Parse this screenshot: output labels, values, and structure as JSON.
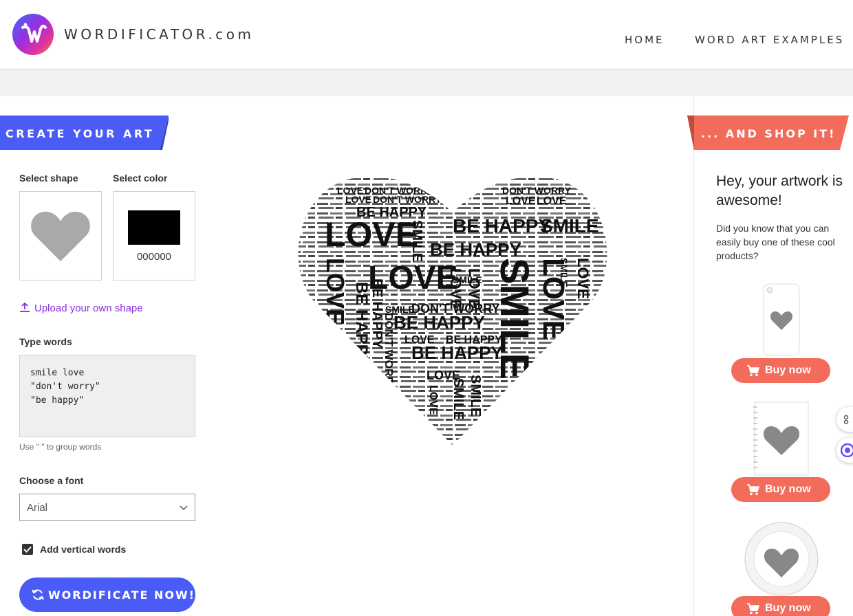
{
  "header": {
    "logo_text": "WORDIFICATOR.com",
    "nav": [
      "HOME",
      "WORD ART EXAMPLES"
    ]
  },
  "left_panel": {
    "banner": "CREATE YOUR ART",
    "select_shape_label": "Select shape",
    "select_color_label": "Select color",
    "selected_shape_icon": "heart-icon",
    "color_value": "000000",
    "color_hex": "#000000",
    "upload_link": "Upload your own shape",
    "type_words_label": "Type words",
    "words_text": "smile love\n\"don't worry\"\n\"be happy\"",
    "hint": "Use \" \" to group words",
    "font_label": "Choose a font",
    "font_value": "Arial",
    "vertical_words_label": "Add vertical words",
    "vertical_words_checked": true,
    "generate_button": "WORDIFICATE NOW!"
  },
  "art": {
    "words": [
      "LOVE",
      "SMILE",
      "BE HAPPY",
      "DON'T WORRY"
    ]
  },
  "right_panel": {
    "banner": "... AND SHOP IT!",
    "headline": "Hey, your artwork is awesome!",
    "description": "Did you know that you can easily buy one of these cool products?",
    "products": [
      {
        "name": "phone-case",
        "button": "Buy now"
      },
      {
        "name": "notebook",
        "button": "Buy now"
      },
      {
        "name": "plate",
        "button": "Buy now"
      }
    ]
  },
  "colors": {
    "accent_blue": "#4a5cf5",
    "accent_coral": "#f36b5b",
    "link_purple": "#8a2be2"
  }
}
